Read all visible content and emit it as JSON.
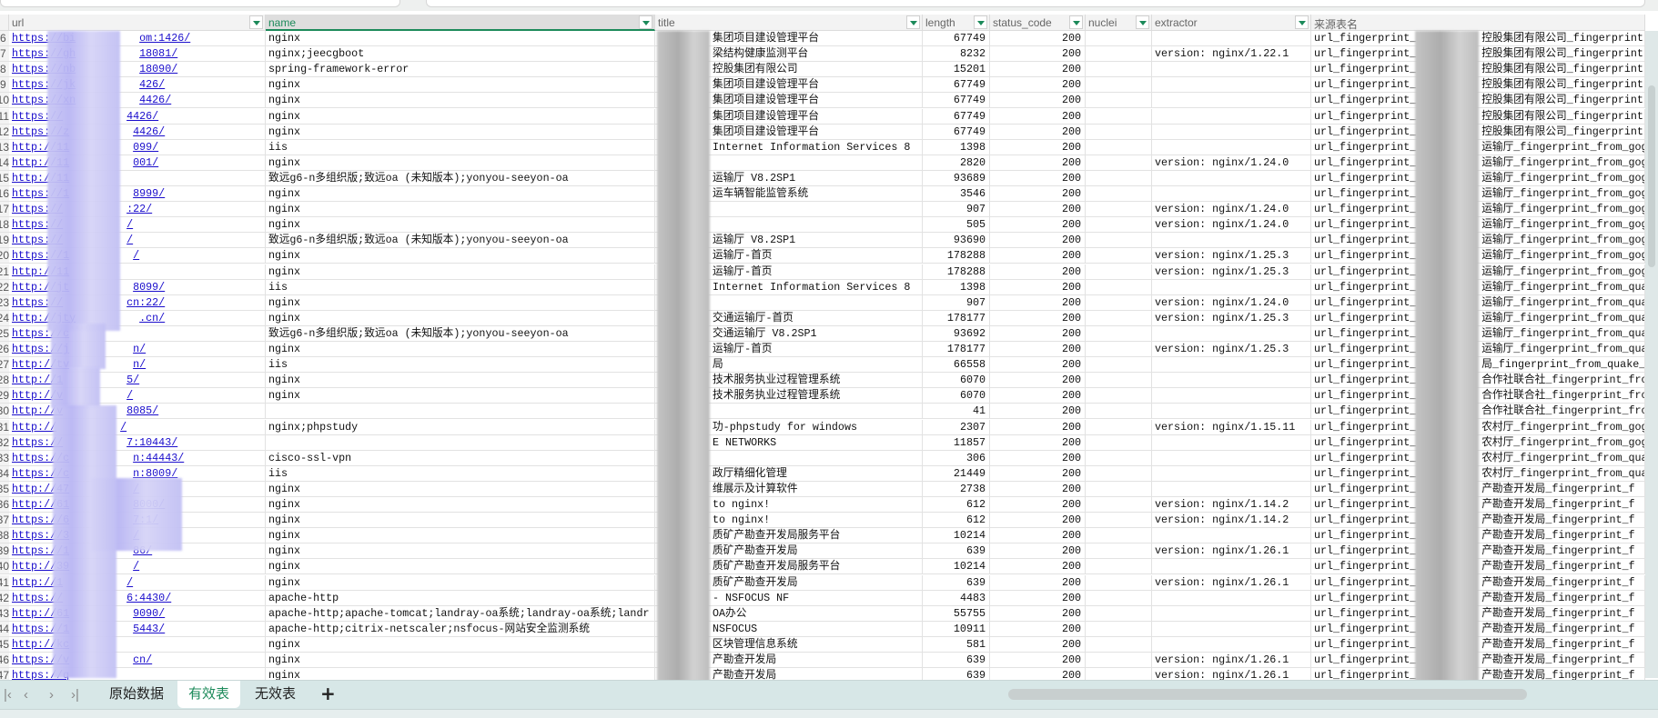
{
  "columns": [
    {
      "key": "url",
      "label": "url"
    },
    {
      "key": "name",
      "label": "name",
      "selected": true
    },
    {
      "key": "title",
      "label": "title"
    },
    {
      "key": "length",
      "label": "length"
    },
    {
      "key": "status_code",
      "label": "status_code"
    },
    {
      "key": "nuclei",
      "label": "nuclei"
    },
    {
      "key": "extractor",
      "label": "extractor"
    },
    {
      "key": "source",
      "label": "来源表名"
    }
  ],
  "rows": [
    {
      "n": "6",
      "u1": "https://bi",
      "u2": "om:1426/",
      "name": "nginx",
      "title": "集团项目建设管理平台",
      "length": "67749",
      "status": "200",
      "ext": "",
      "s1": "url_fingerprint_",
      "s2": "控股集团有限公司_fingerprint"
    },
    {
      "n": "7",
      "u1": "https://gh",
      "u2": "18081/",
      "name": "nginx;jeecgboot",
      "title": "梁结构健康监测平台",
      "length": "8232",
      "status": "200",
      "ext": "version: nginx/1.22.1",
      "s1": "url_fingerprint_",
      "s2": "控股集团有限公司_fingerprint"
    },
    {
      "n": "8",
      "u1": "https://nb",
      "u2": "18090/",
      "name": "spring-framework-error",
      "title": "控股集团有限公司",
      "length": "15201",
      "status": "200",
      "ext": "",
      "s1": "url_fingerprint_",
      "s2": "控股集团有限公司_fingerprint"
    },
    {
      "n": "9",
      "u1": "https://jk",
      "u2": "426/",
      "name": "nginx",
      "title": "集团项目建设管理平台",
      "length": "67749",
      "status": "200",
      "ext": "",
      "s1": "url_fingerprint_",
      "s2": "控股集团有限公司_fingerprint"
    },
    {
      "n": "10",
      "u1": "https://xn",
      "u2": "4426/",
      "name": "nginx",
      "title": "集团项目建设管理平台",
      "length": "67749",
      "status": "200",
      "ext": "",
      "s1": "url_fingerprint_",
      "s2": "控股集团有限公司_fingerprint"
    },
    {
      "n": "11",
      "u1": "https://",
      "u2": "4426/",
      "name": "nginx",
      "title": "集团项目建设管理平台",
      "length": "67749",
      "status": "200",
      "ext": "",
      "s1": "url_fingerprint_",
      "s2": "控股集团有限公司_fingerprint"
    },
    {
      "n": "12",
      "u1": "https://z",
      "u2": "4426/",
      "name": "nginx",
      "title": "集团项目建设管理平台",
      "length": "67749",
      "status": "200",
      "ext": "",
      "s1": "url_fingerprint_",
      "s2": "控股集团有限公司_fingerprint"
    },
    {
      "n": "13",
      "u1": "http://11",
      "u2": "099/",
      "name": "iis",
      "title": "Internet Information Services 8",
      "length": "1398",
      "status": "200",
      "ext": "",
      "s1": "url_fingerprint_",
      "s2": "运输厅_fingerprint_from_gog"
    },
    {
      "n": "14",
      "u1": "http://11",
      "u2": "001/",
      "name": "nginx",
      "title": "",
      "length": "2820",
      "status": "200",
      "ext": "version: nginx/1.24.0",
      "s1": "url_fingerprint_",
      "s2": "运输厅_fingerprint_from_gog"
    },
    {
      "n": "15",
      "u1": "http://11",
      "u2": "",
      "name": "致远g6-n多组织版;致远oa (未知版本);yonyou-seeyon-oa",
      "title": "运输厅 V8.2SP1",
      "length": "93689",
      "status": "200",
      "ext": "",
      "s1": "url_fingerprint_",
      "s2": "运输厅_fingerprint_from_gog"
    },
    {
      "n": "16",
      "u1": "https://1",
      "u2": "8999/",
      "name": "nginx",
      "title": "运车辆智能监管系统",
      "length": "3546",
      "status": "200",
      "ext": "",
      "s1": "url_fingerprint_",
      "s2": "运输厅_fingerprint_from_gog"
    },
    {
      "n": "17",
      "u1": "https://",
      "u2": ":22/",
      "name": "nginx",
      "title": "",
      "length": "907",
      "status": "200",
      "ext": "version: nginx/1.24.0",
      "s1": "url_fingerprint_",
      "s2": "运输厅_fingerprint_from_gog"
    },
    {
      "n": "18",
      "u1": "https://",
      "u2": "/",
      "name": "nginx",
      "title": "",
      "length": "505",
      "status": "200",
      "ext": "version: nginx/1.24.0",
      "s1": "url_fingerprint_",
      "s2": "运输厅_fingerprint_from_gog"
    },
    {
      "n": "19",
      "u1": "https://",
      "u2": "/",
      "name": "致远g6-n多组织版;致远oa (未知版本);yonyou-seeyon-oa",
      "title": "运输厅 V8.2SP1",
      "length": "93690",
      "status": "200",
      "ext": "",
      "s1": "url_fingerprint_",
      "s2": "运输厅_fingerprint_from_gog"
    },
    {
      "n": "20",
      "u1": "https://1",
      "u2": "/",
      "name": "nginx",
      "title": "运输厅-首页",
      "length": "178288",
      "status": "200",
      "ext": "version: nginx/1.25.3",
      "s1": "url_fingerprint_",
      "s2": "运输厅_fingerprint_from_gog"
    },
    {
      "n": "21",
      "u1": "http://11",
      "u2": "",
      "name": "nginx",
      "title": "运输厅-首页",
      "length": "178288",
      "status": "200",
      "ext": "version: nginx/1.25.3",
      "s1": "url_fingerprint_",
      "s2": "运输厅_fingerprint_from_gog"
    },
    {
      "n": "22",
      "u1": "http://jt",
      "u2": "8099/",
      "name": "iis",
      "title": "Internet Information Services 8",
      "length": "1398",
      "status": "200",
      "ext": "",
      "s1": "url_fingerprint_",
      "s2": "运输厅_fingerprint_from_qua"
    },
    {
      "n": "23",
      "u1": "https://",
      "u2": "cn:22/",
      "name": "nginx",
      "title": "",
      "length": "907",
      "status": "200",
      "ext": "version: nginx/1.24.0",
      "s1": "url_fingerprint_",
      "s2": "运输厅_fingerprint_from_qua"
    },
    {
      "n": "24",
      "u1": "http://jty",
      "u2": ".cn/",
      "name": "nginx",
      "title": "交通运输厅-首页",
      "length": "178177",
      "status": "200",
      "ext": "version: nginx/1.25.3",
      "s1": "url_fingerprint_",
      "s2": "运输厅_fingerprint_from_qua"
    },
    {
      "n": "25",
      "u1": "https://c",
      "u2": "",
      "name": "致远g6-n多组织版;致远oa (未知版本);yonyou-seeyon-oa",
      "title": "交通运输厅 V8.2SP1",
      "length": "93692",
      "status": "200",
      "ext": "",
      "s1": "url_fingerprint_",
      "s2": "运输厅_fingerprint_from_qua"
    },
    {
      "n": "26",
      "u1": "https://j",
      "u2": "n/",
      "name": "nginx",
      "title": "运输厅-首页",
      "length": "178177",
      "status": "200",
      "ext": "version: nginx/1.25.3",
      "s1": "url_fingerprint_",
      "s2": "运输厅_fingerprint_from_qua"
    },
    {
      "n": "27",
      "u1": "http://tv",
      "u2": "n/",
      "name": "iis",
      "title": "局",
      "length": "66558",
      "status": "200",
      "ext": "",
      "s1": "url_fingerprint_",
      "s2": "局_fingerprint_from_quake_2"
    },
    {
      "n": "28",
      "u1": "http://1",
      "u2": "5/",
      "name": "nginx",
      "title": "技术服务执业过程管理系统",
      "length": "6070",
      "status": "200",
      "ext": "",
      "s1": "url_fingerprint_",
      "s2": "合作社联合社_fingerprint_fro"
    },
    {
      "n": "29",
      "u1": "http://v",
      "u2": "/",
      "name": "nginx",
      "title": "技术服务执业过程管理系统",
      "length": "6070",
      "status": "200",
      "ext": "",
      "s1": "url_fingerprint_",
      "s2": "合作社联合社_fingerprint_fro"
    },
    {
      "n": "30",
      "u1": "http://v",
      "u2": "8085/",
      "name": "",
      "title": "",
      "length": "41",
      "status": "200",
      "ext": "",
      "s1": "url_fingerprint_",
      "s2": "合作社联合社_fingerprint_fro"
    },
    {
      "n": "31",
      "u1": "http://",
      "u2": "/",
      "name": "nginx;phpstudy",
      "title": "功-phpstudy for windows",
      "length": "2307",
      "status": "200",
      "ext": "version: nginx/1.15.11",
      "s1": "url_fingerprint_",
      "s2": "农村厅_fingerprint_from_gog"
    },
    {
      "n": "32",
      "u1": "https://",
      "u2": "7:10443/",
      "name": "",
      "title": "E NETWORKS",
      "length": "11857",
      "status": "200",
      "ext": "",
      "s1": "url_fingerprint_",
      "s2": "农村厅_fingerprint_from_gog"
    },
    {
      "n": "33",
      "u1": "https://c",
      "u2": "n:44443/",
      "name": "cisco-ssl-vpn",
      "title": "",
      "length": "306",
      "status": "200",
      "ext": "",
      "s1": "url_fingerprint_",
      "s2": "农村厅_fingerprint_from_qua"
    },
    {
      "n": "34",
      "u1": "https://c",
      "u2": "n:8009/",
      "name": "iis",
      "title": "政厅精细化管理",
      "length": "21449",
      "status": "200",
      "ext": "",
      "s1": "url_fingerprint_",
      "s2": "农村厅_fingerprint_from_qua"
    },
    {
      "n": "35",
      "u1": "http://47",
      "u2": "/",
      "name": "nginx",
      "title": "维展示及计算软件",
      "length": "2738",
      "status": "200",
      "ext": "",
      "s1": "url_fingerprint_",
      "s2": "产勘查开发局_fingerprint_f"
    },
    {
      "n": "36",
      "u1": "http://61",
      "u2": "8000/",
      "name": "nginx",
      "title": "to nginx!",
      "length": "612",
      "status": "200",
      "ext": "version: nginx/1.14.2",
      "s1": "url_fingerprint_",
      "s2": "产勘查开发局_fingerprint_f"
    },
    {
      "n": "37",
      "u1": "https://6",
      "u2": "7:1/",
      "name": "nginx",
      "title": "to nginx!",
      "length": "612",
      "status": "200",
      "ext": "version: nginx/1.14.2",
      "s1": "url_fingerprint_",
      "s2": "产勘查开发局_fingerprint_f"
    },
    {
      "n": "38",
      "u1": "https://3",
      "u2": "/",
      "name": "nginx",
      "title": "质矿产勘查开发局服务平台",
      "length": "10214",
      "status": "200",
      "ext": "",
      "s1": "url_fingerprint_",
      "s2": "产勘查开发局_fingerprint_f"
    },
    {
      "n": "39",
      "u1": "https://1",
      "u2": "86/",
      "name": "nginx",
      "title": "质矿产勘查开发局",
      "length": "639",
      "status": "200",
      "ext": "version: nginx/1.26.1",
      "s1": "url_fingerprint_",
      "s2": "产勘查开发局_fingerprint_f"
    },
    {
      "n": "40",
      "u1": "http://39",
      "u2": "/",
      "name": "nginx",
      "title": "质矿产勘查开发局服务平台",
      "length": "10214",
      "status": "200",
      "ext": "",
      "s1": "url_fingerprint_",
      "s2": "产勘查开发局_fingerprint_f"
    },
    {
      "n": "41",
      "u1": "http://1",
      "u2": "/",
      "name": "nginx",
      "title": "质矿产勘查开发局",
      "length": "639",
      "status": "200",
      "ext": "version: nginx/1.26.1",
      "s1": "url_fingerprint_",
      "s2": "产勘查开发局_fingerprint_f"
    },
    {
      "n": "42",
      "u1": "https://",
      "u2": "6:4430/",
      "name": "apache-http",
      "title": "- NSFOCUS NF",
      "length": "4483",
      "status": "200",
      "ext": "",
      "s1": "url_fingerprint_",
      "s2": "产勘查开发局_fingerprint_f"
    },
    {
      "n": "43",
      "u1": "http://61",
      "u2": "9090/",
      "name": "apache-http;apache-tomcat;landray-oa系统;landray-oa系统;landr",
      "title": "OA办公",
      "length": "55755",
      "status": "200",
      "ext": "",
      "s1": "url_fingerprint_",
      "s2": "产勘查开发局_fingerprint_f"
    },
    {
      "n": "44",
      "u1": "https://1",
      "u2": "5443/",
      "name": "apache-http;citrix-netscaler;nsfocus-网站安全监测系统",
      "title": "NSFOCUS",
      "length": "10911",
      "status": "200",
      "ext": "",
      "s1": "url_fingerprint_",
      "s2": "产勘查开发局_fingerprint_f"
    },
    {
      "n": "45",
      "u1": "http://kc",
      "u2": "",
      "name": "nginx",
      "title": "区块管理信息系统",
      "length": "581",
      "status": "200",
      "ext": "",
      "s1": "url_fingerprint_",
      "s2": "产勘查开发局_fingerprint_f"
    },
    {
      "n": "46",
      "u1": "https://v",
      "u2": "cn/",
      "name": "nginx",
      "title": "产勘查开发局",
      "length": "639",
      "status": "200",
      "ext": "version: nginx/1.26.1",
      "s1": "url_fingerprint_",
      "s2": "产勘查开发局_fingerprint_f"
    },
    {
      "n": "47",
      "u1": "https://q",
      "u2": "",
      "name": "nginx",
      "title": "产勘查开发局",
      "length": "639",
      "status": "200",
      "ext": "version: nginx/1.26.1",
      "s1": "url_fingerprint_",
      "s2": "产勘查开发局_fingerprint_f"
    }
  ],
  "sheets": {
    "tabs": [
      {
        "label": "原始数据"
      },
      {
        "label": "有效表",
        "active": true
      },
      {
        "label": "无效表"
      }
    ],
    "add_label": "+"
  },
  "colors": {
    "accent": "#1c8a5a",
    "link": "#1a0dcc"
  }
}
